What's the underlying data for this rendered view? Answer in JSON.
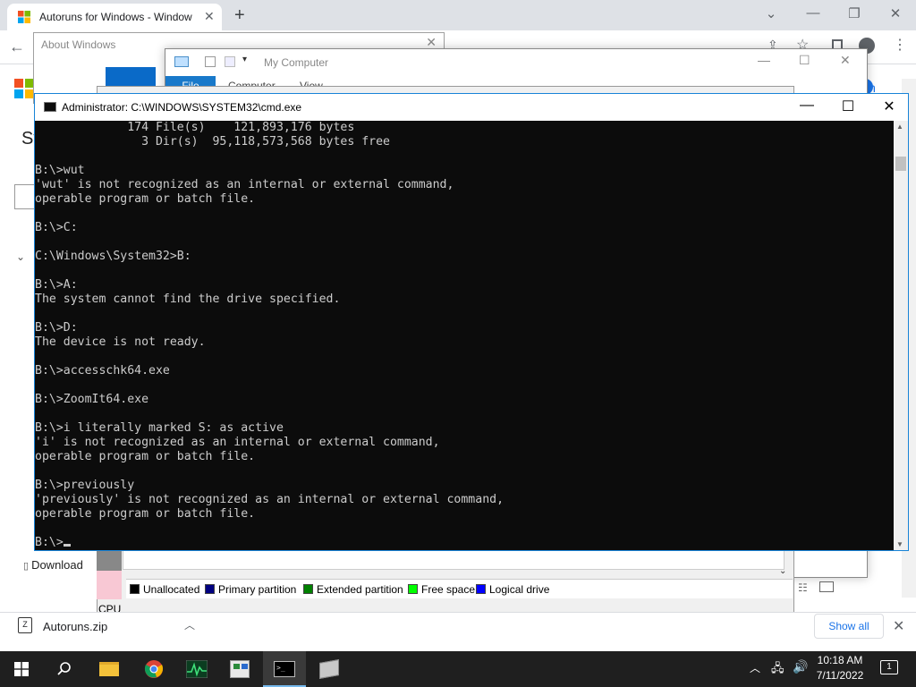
{
  "chrome": {
    "tab_title": "Autoruns for Windows - Window",
    "new_tab": "+",
    "page_heading_fragment": "Sy",
    "download_link": "Download",
    "sign_in_fragment": "in"
  },
  "about_dialog": {
    "title": "About Windows"
  },
  "my_computer": {
    "title": "My Computer",
    "ribbon": [
      "File",
      "Computer",
      "View"
    ]
  },
  "disk_management": {
    "legend": [
      {
        "label": "Unallocated",
        "color": "#000000"
      },
      {
        "label": "Primary partition",
        "color": "#000080"
      },
      {
        "label": "Extended partition",
        "color": "#008000"
      },
      {
        "label": "Free space",
        "color": "#00ff00"
      },
      {
        "label": "Logical drive",
        "color": "#0000ff"
      }
    ],
    "cpu_label": "CPU"
  },
  "cmd": {
    "title": "Administrator: C:\\WINDOWS\\SYSTEM32\\cmd.exe",
    "lines": [
      "             174 File(s)    121,893,176 bytes",
      "               3 Dir(s)  95,118,573,568 bytes free",
      "",
      "B:\\>wut",
      "'wut' is not recognized as an internal or external command,",
      "operable program or batch file.",
      "",
      "B:\\>C:",
      "",
      "C:\\Windows\\System32>B:",
      "",
      "B:\\>A:",
      "The system cannot find the drive specified.",
      "",
      "B:\\>D:",
      "The device is not ready.",
      "",
      "B:\\>accesschk64.exe",
      "",
      "B:\\>ZoomIt64.exe",
      "",
      "B:\\>i literally marked S: as active",
      "'i' is not recognized as an internal or external command,",
      "operable program or batch file.",
      "",
      "B:\\>previously",
      "'previously' is not recognized as an internal or external command,",
      "operable program or batch file.",
      ""
    ],
    "prompt": "B:\\>"
  },
  "download_shelf": {
    "file_name": "Autoruns.zip",
    "show_all": "Show all"
  },
  "taskbar": {
    "time": "10:18 AM",
    "date": "7/11/2022",
    "notification_count": "1",
    "apps": [
      "file-explorer-icon",
      "chrome-icon",
      "resource-monitor-icon",
      "disk-management-icon",
      "cmd-icon",
      "setup-icon"
    ]
  },
  "colors": {
    "accent": "#1883d7",
    "console_bg": "#0c0c0c",
    "console_fg": "#cccccc",
    "taskbar": "#1f1f1f"
  }
}
